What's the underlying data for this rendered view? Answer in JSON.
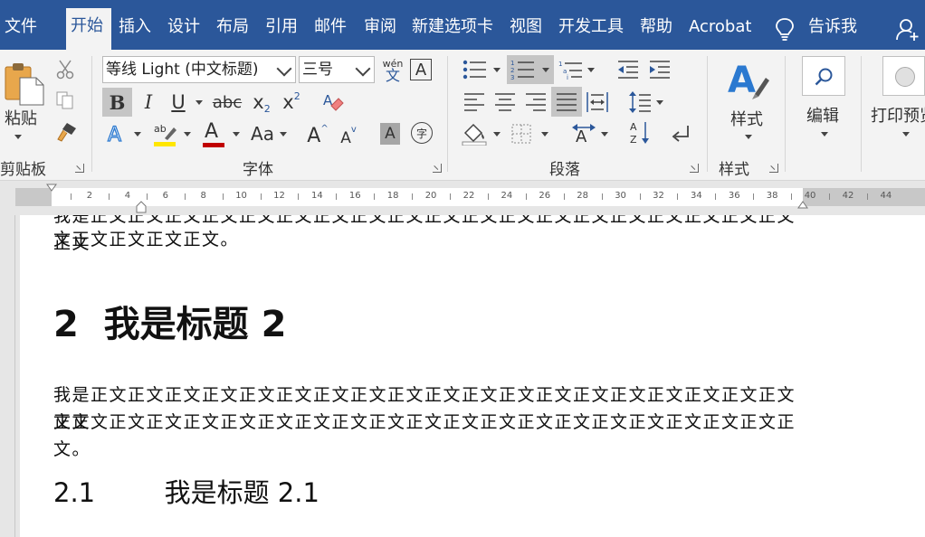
{
  "tabs": [
    "文件",
    "开始",
    "插入",
    "设计",
    "布局",
    "引用",
    "邮件",
    "审阅",
    "新建选项卡",
    "视图",
    "开发工具",
    "帮助",
    "Acrobat"
  ],
  "active_tab": "开始",
  "tell_me": "告诉我",
  "clipboard": {
    "paste_label": "粘贴",
    "group_label": "剪贴板"
  },
  "font": {
    "font_name": "等线 Light (中文标题)",
    "font_size": "三号",
    "group_label": "字体",
    "pinyin_top": "wén",
    "pinyin_bottom": "文",
    "border_char": "A",
    "bold": "B",
    "italic": "I",
    "underline": "U",
    "strike": "abc",
    "sub_base": "x",
    "sub_script": "2",
    "sup_base": "x",
    "sup_script": "2",
    "font_color_char": "A",
    "change_case": "Aa",
    "grow_font": "A",
    "shrink_font": "A",
    "shade_char": "A",
    "enclose_char": "字"
  },
  "paragraph": {
    "group_label": "段落"
  },
  "styles": {
    "label": "样式",
    "group_label": "样式"
  },
  "editing": {
    "label": "编辑"
  },
  "print_preview": {
    "label": "打印预览"
  },
  "ruler": {
    "numbers": [
      "2",
      "4",
      "6",
      "8",
      "10",
      "12",
      "14",
      "16",
      "18",
      "20",
      "22",
      "24",
      "26",
      "28",
      "30",
      "32",
      "34",
      "36",
      "38",
      "40",
      "42",
      "44"
    ]
  },
  "document": {
    "para1_line1": "我是正文正文正文正文正文正文正文正文正文正文正文正文正文正文正文正文正文正文正文正文",
    "para1_line2": "文正文正文正文正文。",
    "heading2": "2  我是标题 2",
    "para2_line1": "我是正文正文正文正文正文正文正文正文正文正文正文正文正文正文正文正文正文正文正文正文",
    "para2_line2": "文正文正文正文正文正文正文正文正文正文正文正文正文正文正文正文正文正文正文正文正文。",
    "heading21_num": "2.1",
    "heading21_text": "我是标题 2.1"
  },
  "colors": {
    "title_bar": "#2b579a",
    "ribbon_bg": "#f3f3f3",
    "highlight_yellow": "#ffe600",
    "font_red": "#c00000",
    "accent_blue": "#2b579a"
  }
}
